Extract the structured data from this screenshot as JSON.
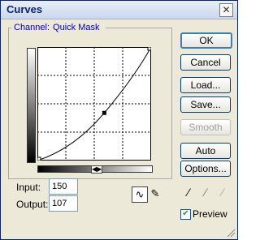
{
  "window": {
    "title": "Curves",
    "close_glyph": "✕"
  },
  "channel": {
    "label": "Channel:",
    "value": "Quick Mask"
  },
  "curve": {
    "input_max": 255,
    "output_max": 255,
    "point": {
      "input": 150,
      "output": 107
    }
  },
  "fields": {
    "input_label": "Input:",
    "input_value": "150",
    "output_label": "Output:",
    "output_value": "107"
  },
  "buttons": {
    "ok": "OK",
    "cancel": "Cancel",
    "load": "Load...",
    "save": "Save...",
    "smooth": "Smooth",
    "auto": "Auto",
    "options": "Options..."
  },
  "preview": {
    "label": "Preview",
    "checked": true
  },
  "icons": [
    "curve-tool-icon",
    "pencil-tool-icon",
    "black-eyedropper-icon",
    "gray-eyedropper-icon",
    "white-eyedropper-icon",
    "gradient-toggle-icon",
    "resize-grip-icon"
  ]
}
